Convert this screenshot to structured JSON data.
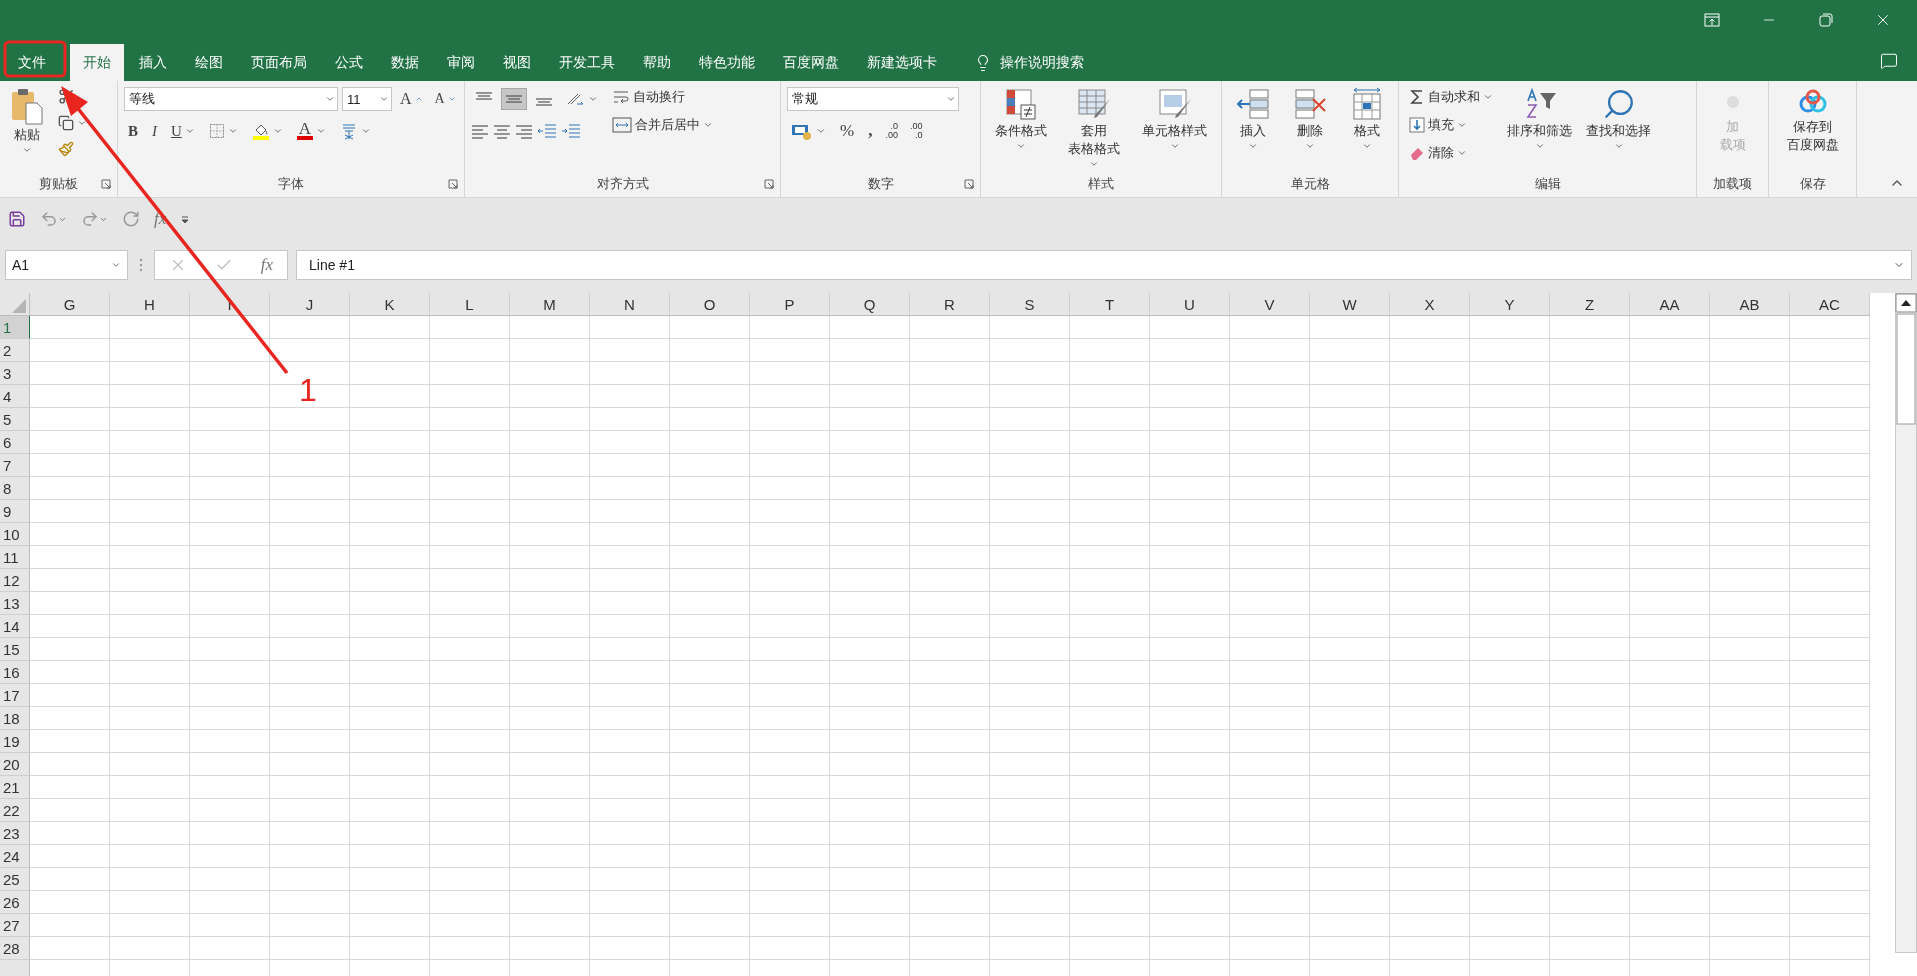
{
  "window_controls": [
    {
      "kind": "ribbon-options"
    },
    {
      "kind": "minimize"
    },
    {
      "kind": "restore"
    },
    {
      "kind": "close"
    }
  ],
  "tabs": [
    {
      "label": "文件",
      "selected": false
    },
    {
      "label": "开始",
      "selected": true
    },
    {
      "label": "插入",
      "selected": false
    },
    {
      "label": "绘图",
      "selected": false
    },
    {
      "label": "页面布局",
      "selected": false
    },
    {
      "label": "公式",
      "selected": false
    },
    {
      "label": "数据",
      "selected": false
    },
    {
      "label": "审阅",
      "selected": false
    },
    {
      "label": "视图",
      "selected": false
    },
    {
      "label": "开发工具",
      "selected": false
    },
    {
      "label": "帮助",
      "selected": false
    },
    {
      "label": "特色功能",
      "selected": false
    },
    {
      "label": "百度网盘",
      "selected": false
    },
    {
      "label": "新建选项卡",
      "selected": false
    }
  ],
  "tell_me": "操作说明搜索",
  "ribbon": [
    {
      "kind": "clipboard",
      "label": "剪贴板",
      "paste": "粘贴"
    },
    {
      "kind": "font",
      "label": "字体",
      "font_name": "等线",
      "font_size": "11",
      "grow": "A",
      "shrink": "A",
      "bold": "B",
      "italic": "I",
      "underline": "U",
      "font_color": "A"
    },
    {
      "kind": "alignment",
      "label": "对齐方式",
      "vertical_align": [
        {
          "selected": false
        },
        {
          "selected": true
        },
        {
          "selected": false
        }
      ],
      "wrap": "自动换行",
      "merge": "合并后居中"
    },
    {
      "kind": "number",
      "label": "数字",
      "format": "常规",
      "percent": "%",
      "comma": ",",
      "increase_decimal": {
        "top": ".0",
        "bottom": ".00"
      },
      "decrease_decimal": {
        "top": ".00",
        "bottom": ".0"
      }
    },
    {
      "kind": "styles",
      "label": "样式",
      "buttons": [
        {
          "kind": "conditional",
          "lines": [
            "条件格式"
          ]
        },
        {
          "kind": "table",
          "lines": [
            "套用",
            "表格格式"
          ]
        },
        {
          "kind": "cell-styles",
          "lines": [
            "单元格样式"
          ]
        }
      ]
    },
    {
      "kind": "cells",
      "label": "单元格",
      "buttons": [
        {
          "kind": "insert",
          "lines": [
            "插入"
          ]
        },
        {
          "kind": "delete",
          "lines": [
            "删除"
          ]
        },
        {
          "kind": "format",
          "lines": [
            "格式"
          ]
        }
      ]
    },
    {
      "kind": "editing",
      "label": "编辑",
      "autosum": "自动求和",
      "fill": "填充",
      "clear": "清除",
      "sort": "排序和筛选",
      "find": "查找和选择"
    },
    {
      "kind": "addins",
      "label": "加载项",
      "button": {
        "lines": [
          "加",
          "载项"
        ],
        "disabled": true
      }
    },
    {
      "kind": "save",
      "label": "保存",
      "button": {
        "lines": [
          "保存到",
          "百度网盘"
        ],
        "disabled": false
      }
    }
  ],
  "quick_access": {
    "function_label": "fx"
  },
  "formula_bar": {
    "name_box": "A1",
    "function_label": "fx",
    "value": "Line #1"
  },
  "sheet": {
    "columns": [
      "G",
      "H",
      "I",
      "J",
      "K",
      "L",
      "M",
      "N",
      "O",
      "P",
      "Q",
      "R",
      "S",
      "T",
      "U",
      "V",
      "W",
      "X",
      "Y",
      "Z",
      "AA",
      "AB",
      "AC"
    ],
    "rows": [
      {
        "label": "1",
        "selected": true
      },
      {
        "label": "2",
        "selected": false
      },
      {
        "label": "3",
        "selected": false
      },
      {
        "label": "4",
        "selected": false
      },
      {
        "label": "5",
        "selected": false
      },
      {
        "label": "6",
        "selected": false
      },
      {
        "label": "7",
        "selected": false
      },
      {
        "label": "8",
        "selected": false
      },
      {
        "label": "9",
        "selected": false
      },
      {
        "label": "10",
        "selected": false
      },
      {
        "label": "11",
        "selected": false
      },
      {
        "label": "12",
        "selected": false
      },
      {
        "label": "13",
        "selected": false
      },
      {
        "label": "14",
        "selected": false
      },
      {
        "label": "15",
        "selected": false
      },
      {
        "label": "16",
        "selected": false
      },
      {
        "label": "17",
        "selected": false
      },
      {
        "label": "18",
        "selected": false
      },
      {
        "label": "19",
        "selected": false
      },
      {
        "label": "20",
        "selected": false
      },
      {
        "label": "21",
        "selected": false
      },
      {
        "label": "22",
        "selected": false
      },
      {
        "label": "23",
        "selected": false
      },
      {
        "label": "24",
        "selected": false
      },
      {
        "label": "25",
        "selected": false
      },
      {
        "label": "26",
        "selected": false
      },
      {
        "label": "27",
        "selected": false
      },
      {
        "label": "28",
        "selected": false
      }
    ]
  },
  "annotation": {
    "label": "1"
  }
}
